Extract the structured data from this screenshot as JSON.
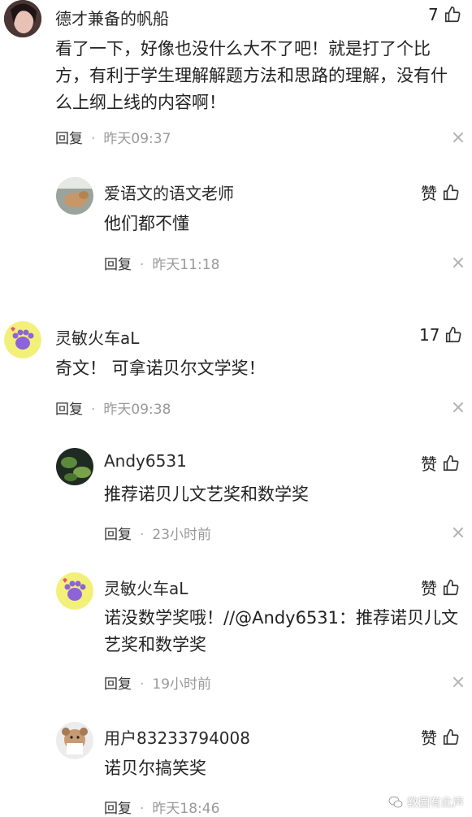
{
  "comments": [
    {
      "user": "德才兼备的帆船",
      "text": "看了一下，好像也没什么大不了吧！就是打了个比方，有利于学生理解解题方法和思路的理解，没有什么上纲上线的内容啊！",
      "reply": "回复",
      "time": "昨天09:37",
      "likes": "7"
    },
    {
      "user": "爱语文的语文老师",
      "text": "他们都不懂",
      "reply": "回复",
      "time": "昨天11:18",
      "likes": "赞"
    },
    {
      "user": "灵敏火车aL",
      "text": "奇文！ 可拿诺贝尔文学奖！",
      "reply": "回复",
      "time": "昨天09:38",
      "likes": "17"
    },
    {
      "user": "Andy6531",
      "text": "推荐诺贝儿文艺奖和数学奖",
      "reply": "回复",
      "time": "23小时前",
      "likes": "赞"
    },
    {
      "user": "灵敏火车aL",
      "text": "诺没数学奖哦！//@Andy6531：推荐诺贝儿文艺奖和数学奖",
      "reply": "回复",
      "time": "19小时前",
      "likes": "赞"
    },
    {
      "user": "用户83233794008",
      "text": "诺贝尔搞笑奖",
      "reply": "回复",
      "time": "昨天18:46",
      "likes": "赞"
    }
  ],
  "watermark": "教园有此声",
  "icons": {
    "like": "thumbs-up-icon",
    "close": "close-icon",
    "watermark": "wechat-icon"
  }
}
